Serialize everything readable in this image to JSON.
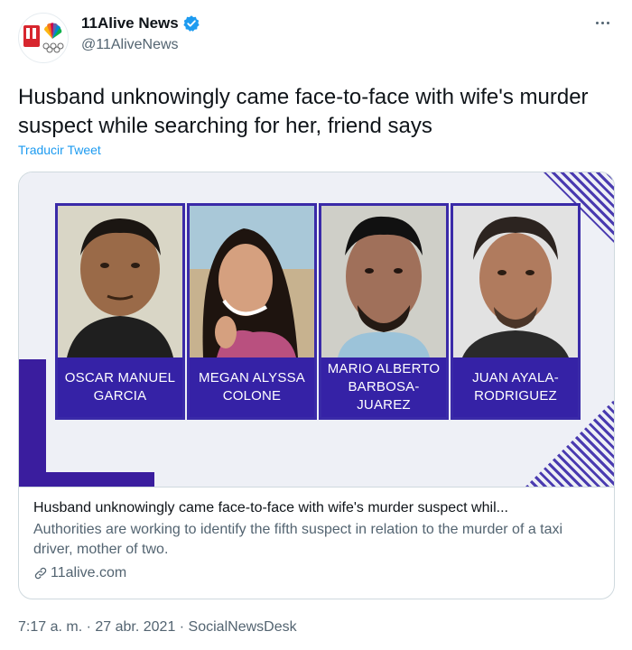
{
  "account": {
    "display_name": "11Alive News",
    "handle": "@11AliveNews"
  },
  "tweet": {
    "text": "Husband unknowingly came face-to-face with wife's murder suspect while searching for her, friend says",
    "translate_label": "Traducir Tweet",
    "timestamp": "7:17 a. m. · 27 abr. 2021 · SocialNewsDesk"
  },
  "card": {
    "suspects": [
      {
        "name": "OSCAR MANUEL GARCIA"
      },
      {
        "name": "MEGAN ALYSSA COLONE"
      },
      {
        "name": "MARIO ALBERTO BARBOSA-JUAREZ"
      },
      {
        "name": "JUAN AYALA-RODRIGUEZ"
      }
    ],
    "title": "Husband unknowingly came face-to-face with wife's murder suspect whil...",
    "description": "Authorities are working to identify the fifth suspect in relation to the murder of a taxi driver, mother of two.",
    "domain": "11alive.com"
  },
  "icons": {
    "verified": "verified-badge-icon",
    "more": "more-options-icon",
    "link": "link-icon"
  },
  "colors": {
    "accent": "#1d9bf0",
    "caption_bg": "#3522a6",
    "brand_red": "#d7262e"
  }
}
